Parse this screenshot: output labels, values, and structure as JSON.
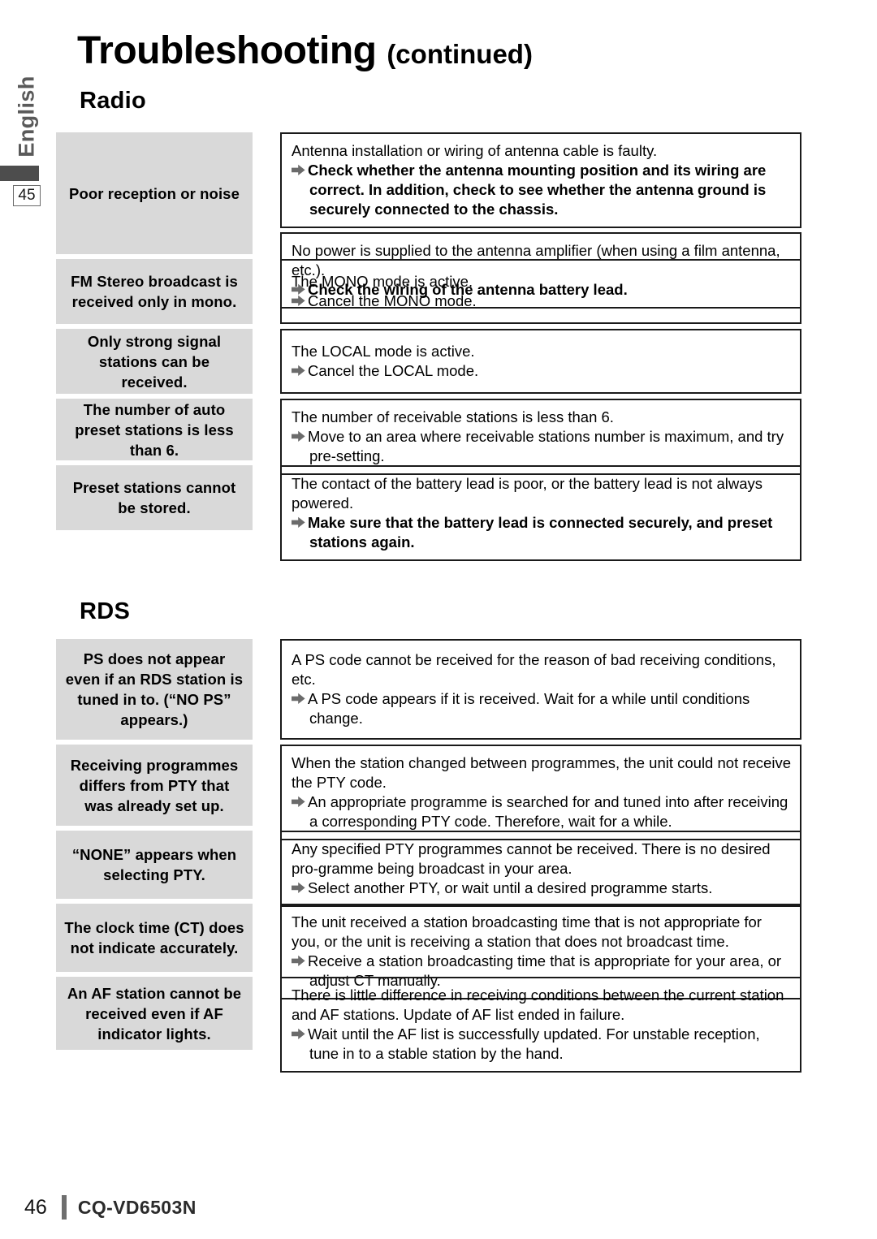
{
  "header": {
    "title": "Troubleshooting",
    "title_suffix": "(continued)"
  },
  "side_tab": {
    "language": "English",
    "page_number": "45"
  },
  "sections": [
    {
      "id": "radio",
      "heading": "Radio",
      "rows": [
        {
          "symptom": "Poor reception or noise",
          "boxes": [
            {
              "cause": "Antenna installation or wiring of antenna cable is faulty.",
              "remedy": "Check whether the antenna mounting position and its wiring are correct. In addition, check to see whether the antenna ground is securely connected to the chassis.",
              "remedy_bold": true
            },
            {
              "cause": "No power is supplied to the antenna amplifier (when using a film antenna, etc.).",
              "remedy": "Check the wiring of the antenna battery lead.",
              "remedy_bold": true
            }
          ]
        },
        {
          "symptom": "FM Stereo broadcast is received only in mono.",
          "boxes": [
            {
              "cause": "The MONO mode is active.",
              "remedy": "Cancel the MONO mode.",
              "remedy_bold": false
            }
          ]
        },
        {
          "symptom": "Only strong signal stations can be received.",
          "boxes": [
            {
              "cause": "The LOCAL mode is active.",
              "remedy": "Cancel the LOCAL mode.",
              "remedy_bold": false
            }
          ]
        },
        {
          "symptom": "The number of auto preset stations is less than 6.",
          "boxes": [
            {
              "cause": "The number of receivable stations is less than 6.",
              "remedy": "Move to an area where receivable stations number is maximum, and try pre-setting.",
              "remedy_bold": false
            }
          ]
        },
        {
          "symptom": "Preset stations cannot be stored.",
          "boxes": [
            {
              "cause": "The contact of the battery lead is poor, or the battery lead is not always powered.",
              "remedy": "Make sure that the battery lead is connected securely, and preset stations again.",
              "remedy_bold": true
            }
          ]
        }
      ]
    },
    {
      "id": "rds",
      "heading": "RDS",
      "rows": [
        {
          "symptom": "PS does not appear even if an RDS station is tuned in to. (“NO PS” appears.)",
          "boxes": [
            {
              "cause": "A PS code cannot be received for the reason of bad receiving conditions, etc.",
              "remedy": "A PS code appears if it is received. Wait for a while until conditions change.",
              "remedy_bold": false
            }
          ]
        },
        {
          "symptom": "Receiving programmes differs from PTY that was already set up.",
          "boxes": [
            {
              "cause": "When the station changed between programmes, the unit could not receive the PTY code.",
              "remedy": "An appropriate programme is searched for and tuned into after receiving a corresponding PTY code. Therefore, wait for a while.",
              "remedy_bold": false
            }
          ]
        },
        {
          "symptom": "“NONE” appears when selecting PTY.",
          "boxes": [
            {
              "cause": "Any specified PTY programmes cannot be received. There is no desired pro-gramme being broadcast in your area.",
              "remedy": "Select another PTY, or wait until a desired programme starts.",
              "remedy_bold": false
            }
          ]
        },
        {
          "symptom": "The clock time (CT) does not indicate accurately.",
          "boxes": [
            {
              "cause": "The unit received a station broadcasting time that is not appropriate for you, or the unit is receiving a station that does not broadcast time.",
              "remedy": "Receive a station broadcasting time that is appropriate for your area, or adjust CT manually.",
              "remedy_bold": false
            }
          ]
        },
        {
          "symptom": "An AF station cannot be received even if AF indicator lights.",
          "boxes": [
            {
              "cause": "There is little difference in receiving conditions between the current station and AF stations. Update of AF list ended in failure.",
              "remedy": "Wait until the AF list is successfully updated. For unstable reception, tune in to a stable station by the hand.",
              "remedy_bold": false
            }
          ]
        }
      ]
    }
  ],
  "footer": {
    "page_number": "46",
    "model": "CQ-VD6503N"
  },
  "colors": {
    "symptom_bg": "#d9d9d9",
    "box_border": "#1a1a1a",
    "arrow": "#6b6b6b",
    "tab_text": "#5a5a5a",
    "tab_bar": "#4d4d4d"
  }
}
